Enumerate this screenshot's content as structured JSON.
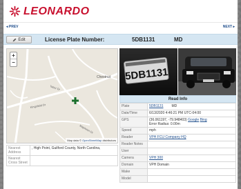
{
  "brand": {
    "name": "LEONARDO",
    "color": "#c8102e",
    "logo_icon": "leonardo-star-icon"
  },
  "nav": {
    "prev": "◂ PREV",
    "next": "NEXT ▸"
  },
  "plate_bar": {
    "edit_label": "Edit",
    "label": "License Plate Number:",
    "plate": "5DB1131",
    "state": "MD"
  },
  "map": {
    "zoom_in": "+",
    "zoom_out": "−",
    "attribution_prefix": "Map data ©",
    "attribution_link": "OpenStreetMap",
    "attribution_suffix": "distributors",
    "road_labels": [
      "Chestnut",
      "Tabor Dr",
      "Kingsfield Dr",
      "Mapleton Dr"
    ],
    "marker_icon": "map-pin-icon"
  },
  "location": {
    "rows": [
      {
        "key": "Nearest Address",
        "value": ", High Point, Guilford County, North Carolina,"
      },
      {
        "key": "Nearest Cross Street",
        "value": ""
      }
    ]
  },
  "images": {
    "plate_text": "5DB1131",
    "plate_alt": "license-plate-closeup",
    "car_alt": "vehicle-overview"
  },
  "read_info": {
    "title": "Read Info",
    "plate_key": "Plate",
    "plate_value": "5DB1131",
    "plate_state": "MD",
    "datetime_key": "Date/Time",
    "datetime_value": "6/13/2020 4:46:21 PM UTC-04:00",
    "gps_key": "GPS",
    "gps_coords": "(36.061197, -79.948403)",
    "gps_google": "Google",
    "gps_bing": "Bing",
    "gps_error": "Error Radius: 0.00m",
    "speed_key": "Speed",
    "speed_value": "mph",
    "reader_key": "Reader",
    "reader_value": "VPH FCU Company HQ",
    "reader_notes_key": "Reader Notes",
    "reader_notes_value": "",
    "user_key": "User",
    "user_value": "",
    "camera_key": "Camera",
    "camera_value": "VPH 300",
    "domain_key": "Domain",
    "domain_value": "VPH Domain",
    "make_key": "Make",
    "make_value": "",
    "model_key": "Model",
    "model_value": ""
  }
}
